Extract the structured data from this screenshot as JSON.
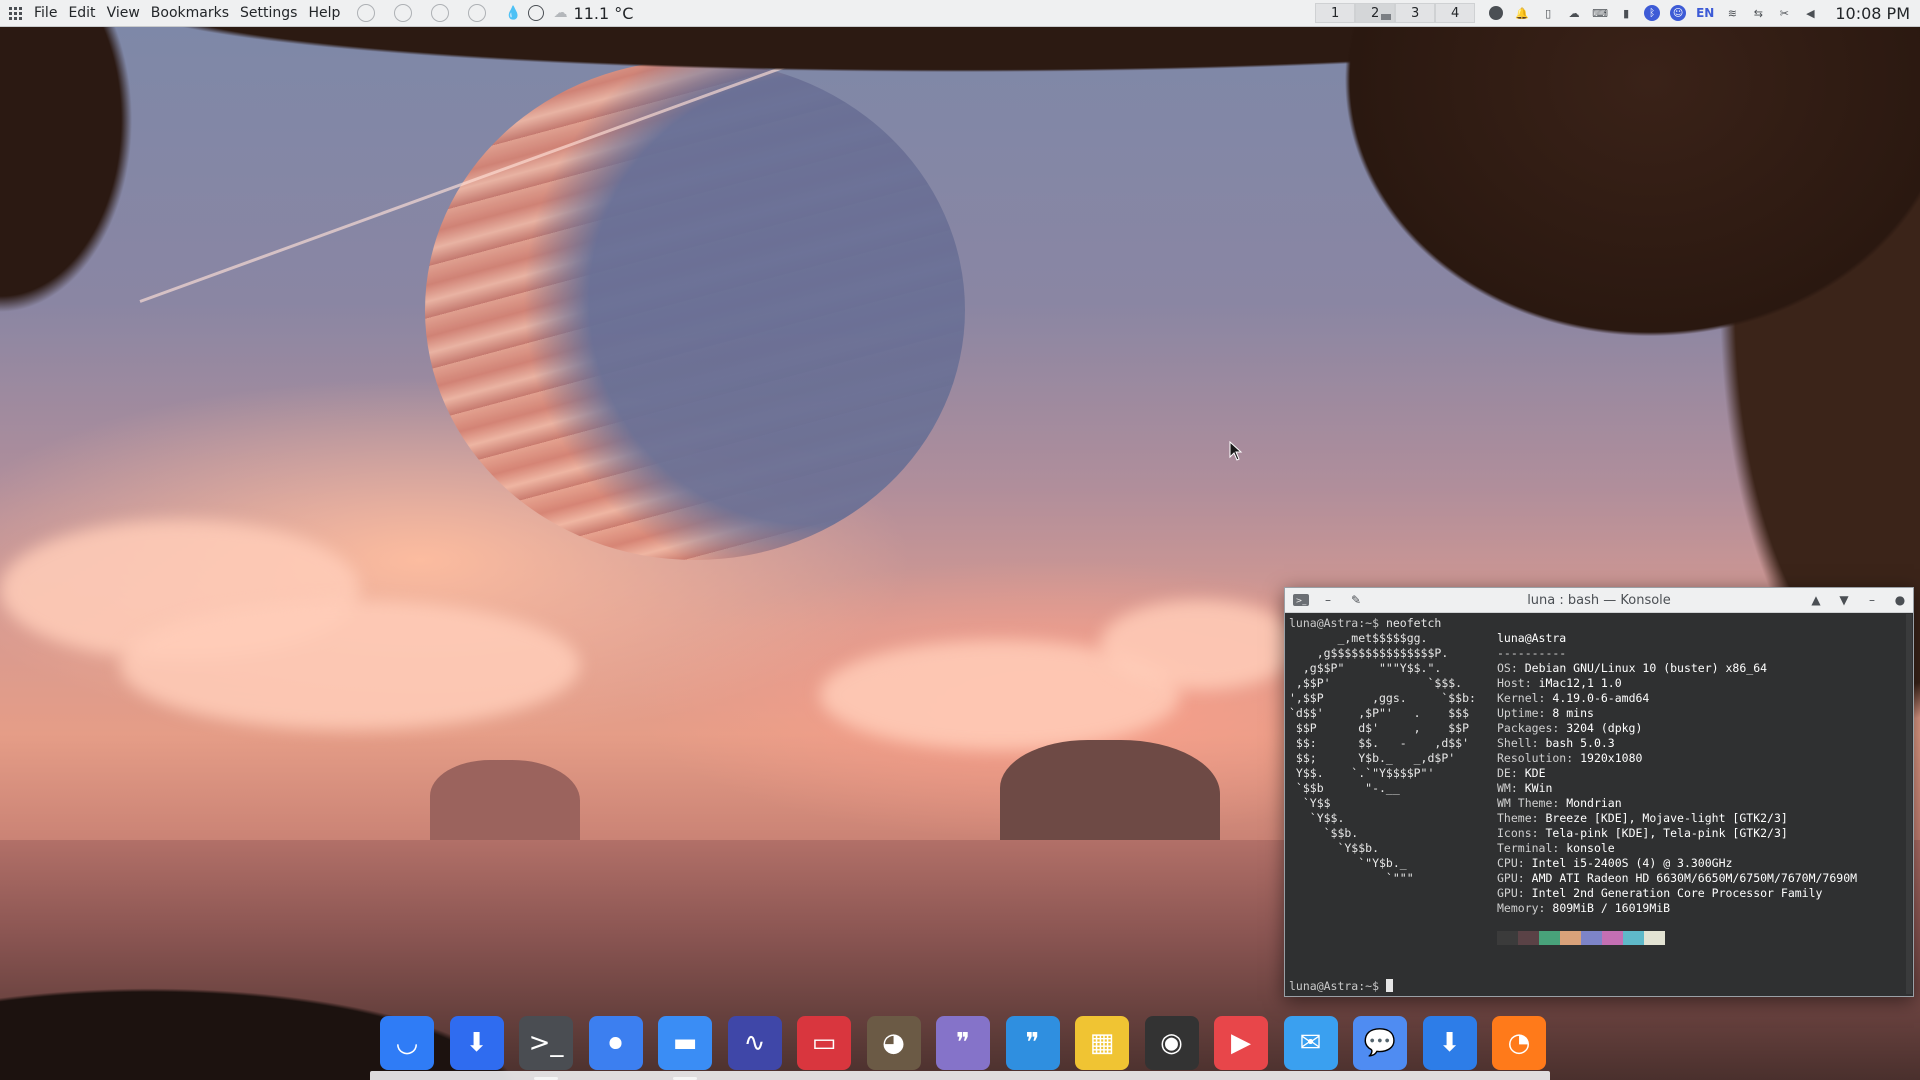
{
  "top_panel": {
    "menus": [
      "File",
      "Edit",
      "View",
      "Bookmarks",
      "Settings",
      "Help"
    ],
    "temperature": "11.1 °C",
    "desktops": [
      "1",
      "2",
      "3",
      "4"
    ],
    "language": "EN",
    "clock": "10:08 PM"
  },
  "konsole": {
    "title": "luna : bash — Konsole",
    "prompt": "luna@Astra:~$",
    "command": "neofetch",
    "logo_lines": [
      "       _,met$$$$$gg.",
      "    ,g$$$$$$$$$$$$$$$P.",
      "  ,g$$P\"     \"\"\"Y$$.\".",
      " ,$$P'              `$$$.",
      "',$$P       ,ggs.     `$$b:",
      "`d$$'     ,$P\"'   .    $$$",
      " $$P      d$'     ,    $$P",
      " $$:      $$.   -    ,d$$'",
      " $$;      Y$b._   _,d$P'",
      " Y$$.    `.`\"Y$$$$P\"'",
      " `$$b      \"-.__",
      "  `Y$$",
      "   `Y$$.",
      "     `$$b.",
      "       `Y$$b.",
      "          `\"Y$b._",
      "              `\"\"\""
    ],
    "user_host": "luna@Astra",
    "separator": "----------",
    "info": [
      {
        "key": "OS",
        "value": "Debian GNU/Linux 10 (buster) x86_64"
      },
      {
        "key": "Host",
        "value": "iMac12,1 1.0"
      },
      {
        "key": "Kernel",
        "value": "4.19.0-6-amd64"
      },
      {
        "key": "Uptime",
        "value": "8 mins"
      },
      {
        "key": "Packages",
        "value": "3204 (dpkg)"
      },
      {
        "key": "Shell",
        "value": "bash 5.0.3"
      },
      {
        "key": "Resolution",
        "value": "1920x1080"
      },
      {
        "key": "DE",
        "value": "KDE"
      },
      {
        "key": "WM",
        "value": "KWin"
      },
      {
        "key": "WM Theme",
        "value": "Mondrian"
      },
      {
        "key": "Theme",
        "value": "Breeze [KDE], Mojave-light [GTK2/3]"
      },
      {
        "key": "Icons",
        "value": "Tela-pink [KDE], Tela-pink [GTK2/3]"
      },
      {
        "key": "Terminal",
        "value": "konsole"
      },
      {
        "key": "CPU",
        "value": "Intel i5-2400S (4) @ 3.300GHz"
      },
      {
        "key": "GPU",
        "value": "AMD ATI Radeon HD 6630M/6650M/6750M/7670M/7690M"
      },
      {
        "key": "GPU",
        "value": "Intel 2nd Generation Core Processor Family"
      },
      {
        "key": "Memory",
        "value": "809MiB / 16019MiB"
      }
    ],
    "swatch_colors": [
      "#3b3b3b",
      "#5a4246",
      "#48a27a",
      "#d9a27a",
      "#7d84c8",
      "#c46fb3",
      "#5fb9c9",
      "#e3e3d3"
    ]
  },
  "dock": {
    "apps": [
      {
        "name": "store-icon",
        "color": "#2f7cf6",
        "glyph": "◡"
      },
      {
        "name": "downloader-icon",
        "color": "#2f6cf0",
        "glyph": "⬇"
      },
      {
        "name": "terminal-icon",
        "color": "#4a4d52",
        "glyph": ">_"
      },
      {
        "name": "settings-toggle-icon",
        "color": "#3c7ff0",
        "glyph": "⏺"
      },
      {
        "name": "file-manager-icon",
        "color": "#3a8df5",
        "glyph": "▬"
      },
      {
        "name": "system-monitor-icon",
        "color": "#3f47a8",
        "glyph": "∿"
      },
      {
        "name": "book-reader-icon",
        "color": "#d9363e",
        "glyph": "▭"
      },
      {
        "name": "gimp-icon",
        "color": "#6b5a45",
        "glyph": "◕"
      },
      {
        "name": "notes-purple-icon",
        "color": "#8573c9",
        "glyph": "❞"
      },
      {
        "name": "notes-blue-icon",
        "color": "#2f8fe0",
        "glyph": "❞"
      },
      {
        "name": "mondrian-icon",
        "color": "#f0c433",
        "glyph": "▦"
      },
      {
        "name": "music-player-icon",
        "color": "#333333",
        "glyph": "◉"
      },
      {
        "name": "video-player-icon",
        "color": "#e8464a",
        "glyph": "▶"
      },
      {
        "name": "mail-icon",
        "color": "#3aa0f0",
        "glyph": "✉"
      },
      {
        "name": "messaging-icon",
        "color": "#4f8cf2",
        "glyph": "💬"
      },
      {
        "name": "updater-icon",
        "color": "#2d7de8",
        "glyph": "⬇"
      },
      {
        "name": "firefox-icon",
        "color": "#ff7a1a",
        "glyph": "◔"
      }
    ]
  }
}
